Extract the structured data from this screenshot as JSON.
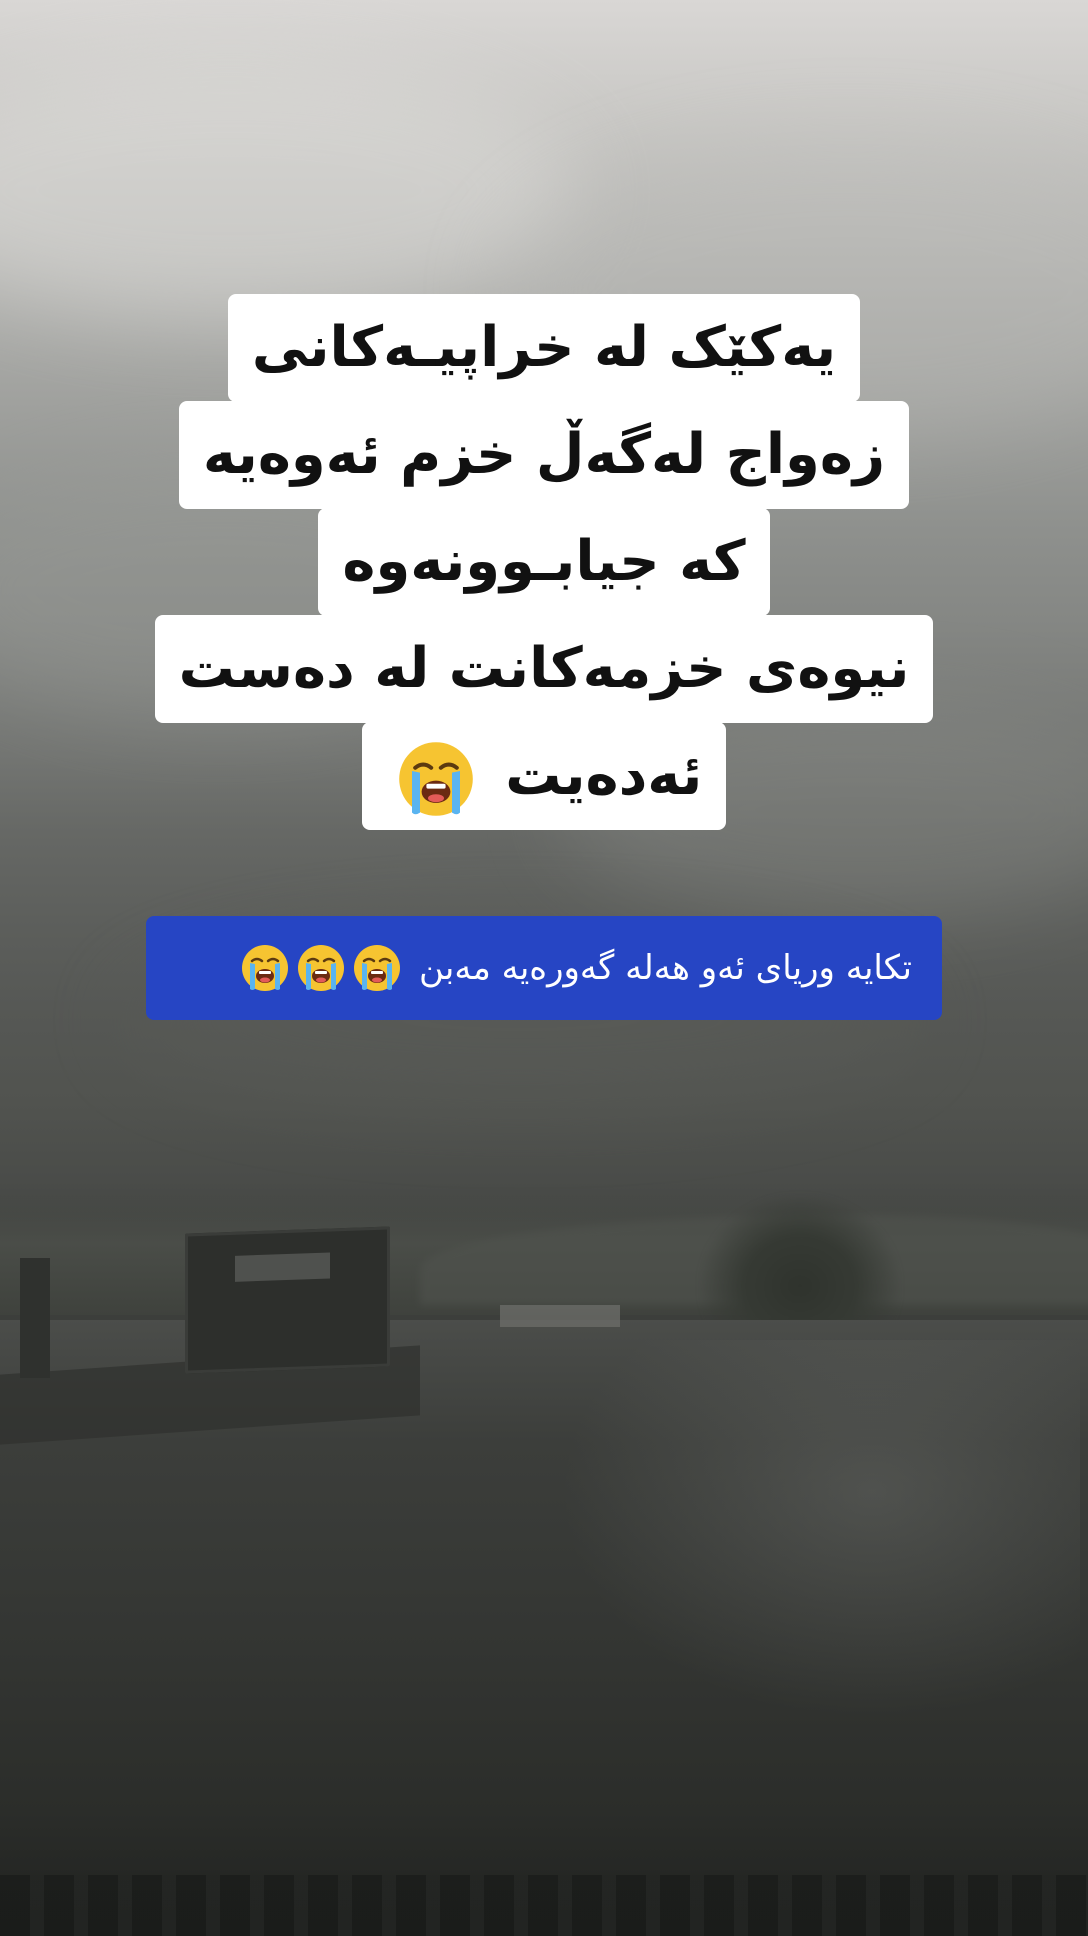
{
  "caption": {
    "line1": "یەکێک لە خراپیـەکانی",
    "line2": "زەواج لەگەڵ خزم ئەوەیە",
    "line3": "کە جیابـوونەوە",
    "line4": "نیوەی خزمەکانت لە دەست",
    "line5": "ئەدەیت",
    "line5_emoji": "loudly-crying-face-icon"
  },
  "banner": {
    "text": "تکایە وریای ئەو هەلە گەورەیە مەبن",
    "emoji": "loudly-crying-face-icon",
    "emoji_count": 3,
    "background": "#2645c4"
  },
  "background": {
    "scene": "overcast-sky-wet-road",
    "sky_color": "#c9c8c5",
    "ground_color": "#343633"
  }
}
